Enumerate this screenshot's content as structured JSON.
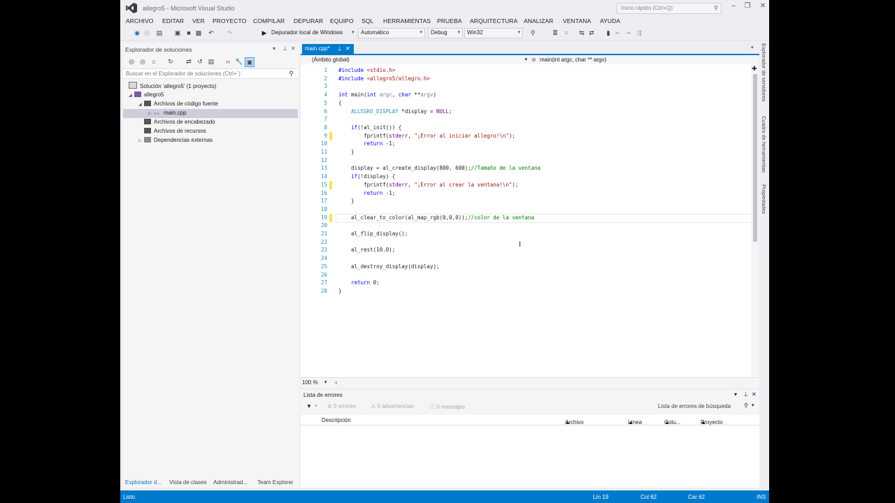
{
  "window": {
    "title": "allegro5 - Microsoft Visual Studio",
    "quick_launch": "Inicio rápido (Ctrl+Q)"
  },
  "menu": [
    "ARCHIVO",
    "EDITAR",
    "VER",
    "PROYECTO",
    "COMPILAR",
    "DEPURAR",
    "EQUIPO",
    "SQL",
    "HERRAMIENTAS",
    "PRUEBA",
    "ARQUITECTURA",
    "ANALIZAR",
    "VENTANA",
    "AYUDA"
  ],
  "toolbar": {
    "debugger": "Depurador local de Windows",
    "mode": "Automático",
    "config": "Debug",
    "platform": "Win32"
  },
  "solution_explorer": {
    "title": "Explorador de soluciones",
    "search_placeholder": "Buscar en el Explorador de soluciones (Ctrl+´)",
    "solution": "Solución 'allegro5' (1 proyecto)",
    "project": "allegro5",
    "source_folder": "Archivos de código fuente",
    "source_file": "main.cpp",
    "header_folder": "Archivos de encabezado",
    "resource_folder": "Archivos de recursos",
    "external": "Dependencias externas",
    "bottom_tabs": [
      "Explorador d...",
      "Vista de clases",
      "Administrad...",
      "Team Explorer"
    ]
  },
  "editor": {
    "tab": "main.cpp*",
    "scope": "(Ámbito global)",
    "member": "main(int argc, char ** argv)",
    "zoom": "100 %",
    "lines": [
      "#include <stdio.h>",
      "#include <allegro5/allegro.h>",
      "",
      "int main(int argc, char **argv)",
      "{",
      "    ALLEGRO_DISPLAY *display = NULL;",
      "",
      "    if(!al_init()) {",
      "        fprintf(stderr, \"¡Error al iniciar allegro!\\n\");",
      "        return -1;",
      "    }",
      "",
      "    display = al_create_display(800, 600);//Tamaño de la ventana",
      "    if(!display) {",
      "        fprintf(stderr, \"¡Error al crear la ventana!\\n\");",
      "        return -1;",
      "    }",
      "",
      "    al_clear_to_color(al_map_rgb(0,0,0));//color de la ventana",
      "",
      "    al_flip_display();",
      "",
      "    al_rest(10.0);",
      "",
      "    al_destroy_display(display);",
      "",
      "    return 0;",
      "}"
    ]
  },
  "error_list": {
    "title": "Lista de errores",
    "errors": "0 errores",
    "warnings": "0 advertencias",
    "messages": "0 mensajes",
    "search": "Lista de errores de búsqueda",
    "columns": [
      "Descripción",
      "Archivo",
      "Línea",
      "Colu...",
      "Proyecto"
    ]
  },
  "side_rail": [
    "Explorador de servidores",
    "Cuadro de herramientas",
    "Propiedades"
  ],
  "status": {
    "text": "Listo",
    "line": "Lín 19",
    "col": "Col 62",
    "char": "Car 62",
    "mode": "INS"
  },
  "colors": {
    "accent": "#007acc",
    "keyword": "#0000ff",
    "string": "#a31515",
    "comment": "#008000",
    "type": "#2b91af",
    "macro": "#6f008a"
  }
}
